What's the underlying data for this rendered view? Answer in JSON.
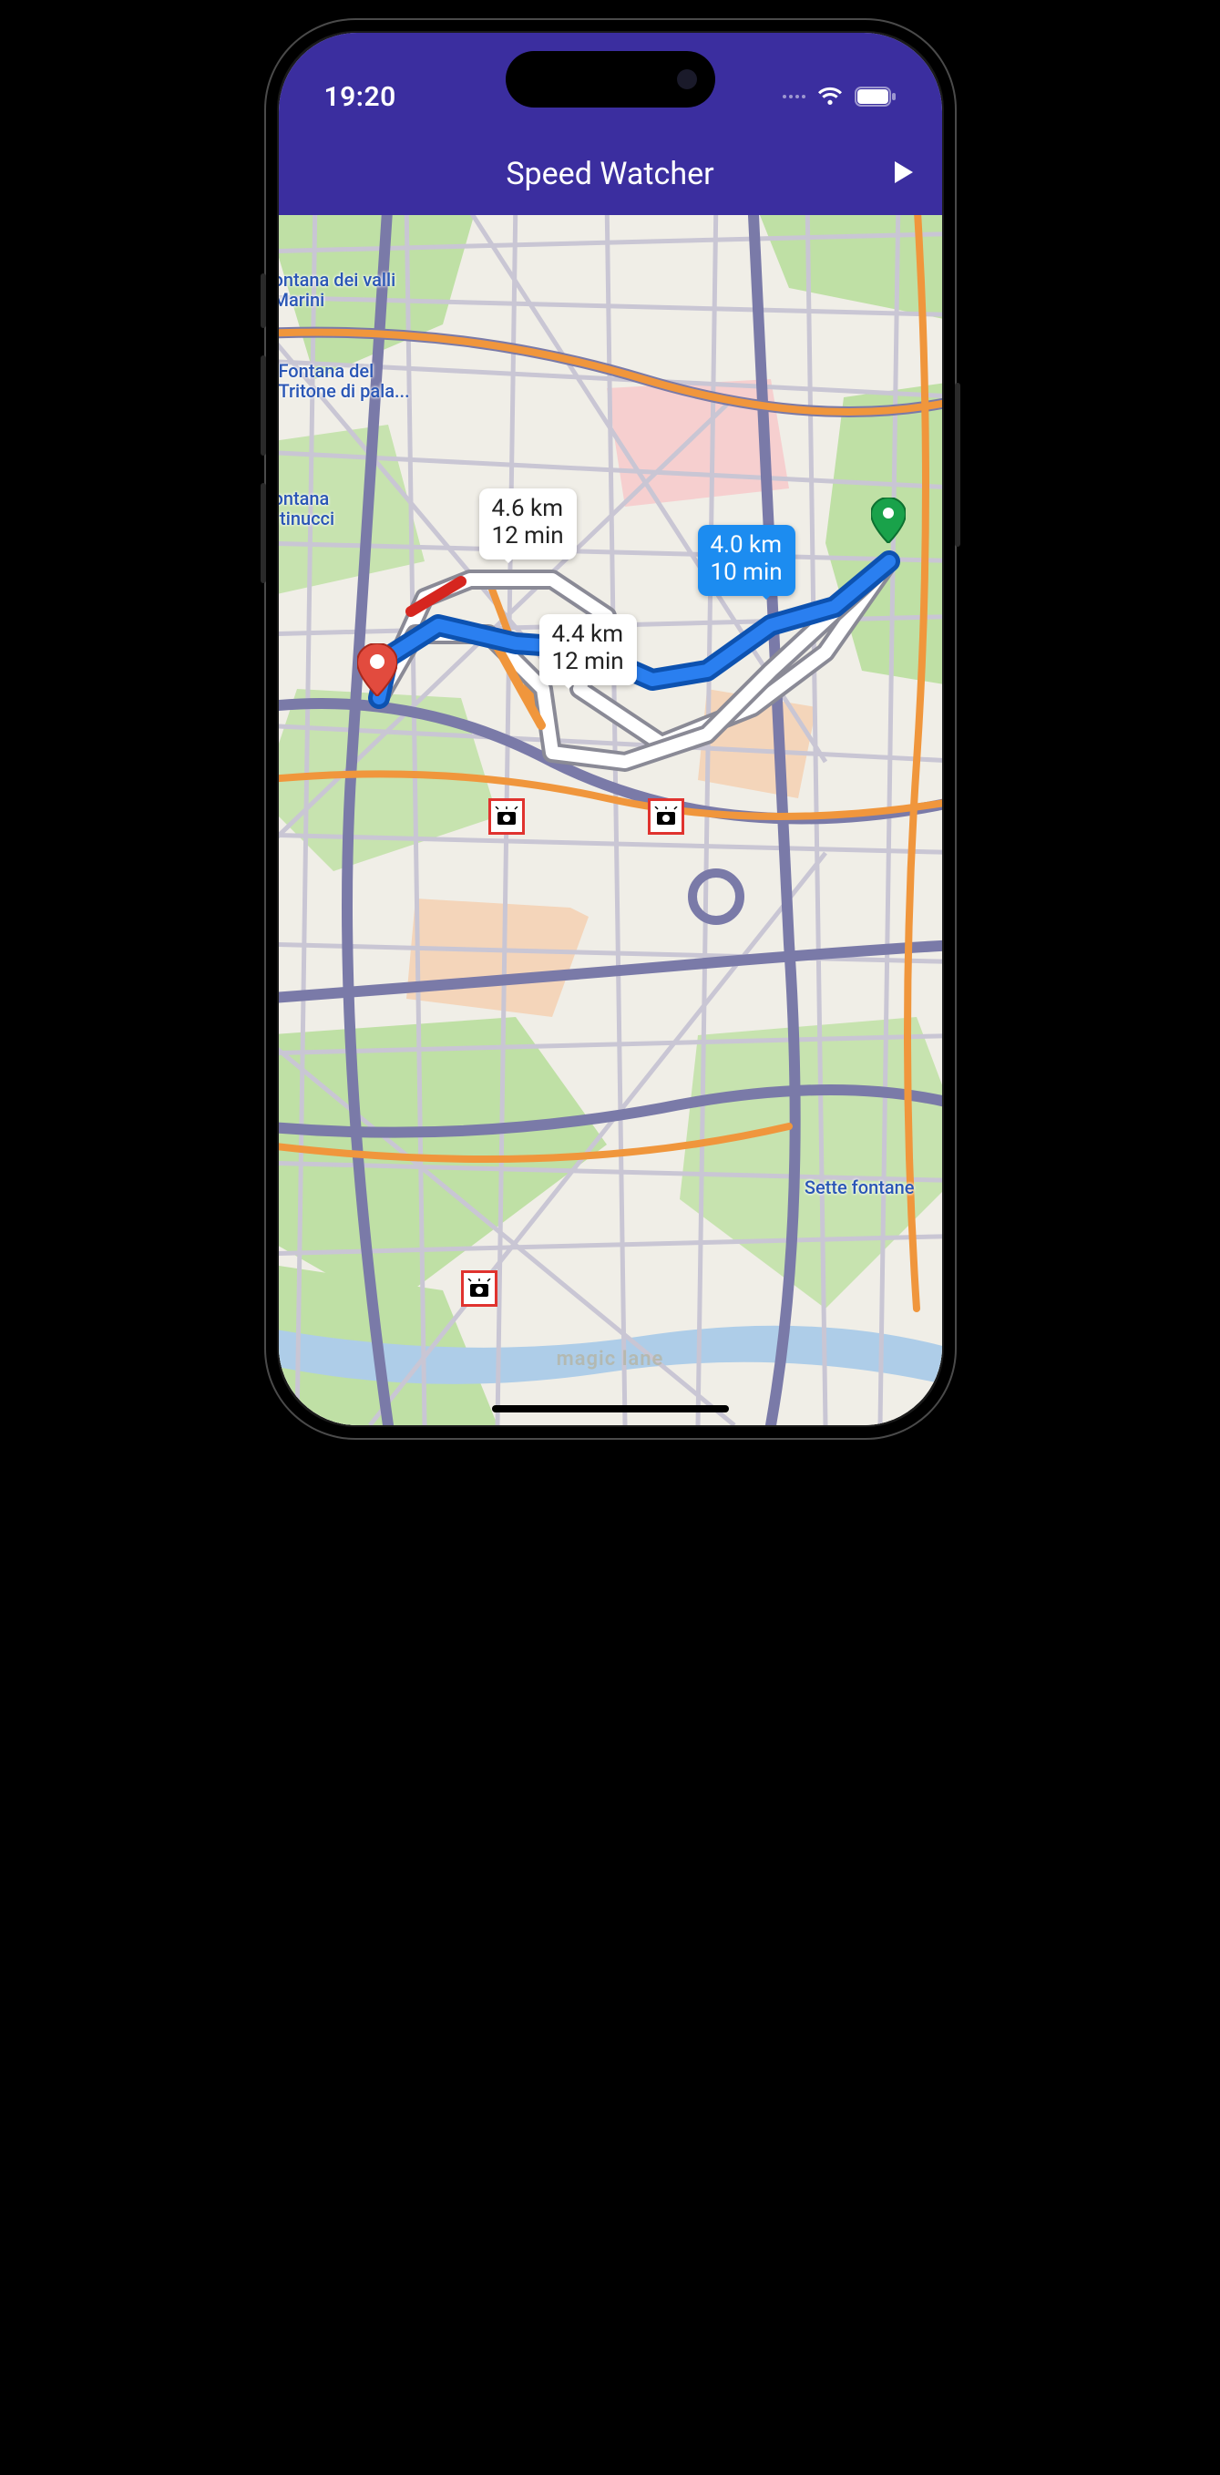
{
  "status": {
    "time": "19:20",
    "wifi_icon": "wifi",
    "battery_icon": "battery-full"
  },
  "header": {
    "title": "Speed Watcher",
    "action_icon": "play"
  },
  "routes": {
    "a": {
      "distance": "4.6 km",
      "duration": "12 min",
      "selected": false
    },
    "b": {
      "distance": "4.4 km",
      "duration": "12 min",
      "selected": false
    },
    "c": {
      "distance": "4.0 km",
      "duration": "10 min",
      "selected": true
    }
  },
  "map_labels": {
    "l1": "ontana dei\nvalli Marini",
    "l2": "Fontana del\nTritone di\npala...",
    "l3": "ontana\nrtinucci",
    "l4": "Sette fontane"
  },
  "markers": {
    "origin": "green-pin",
    "destination": "red-pin",
    "cameras": 3
  },
  "watermark": "magic lane"
}
